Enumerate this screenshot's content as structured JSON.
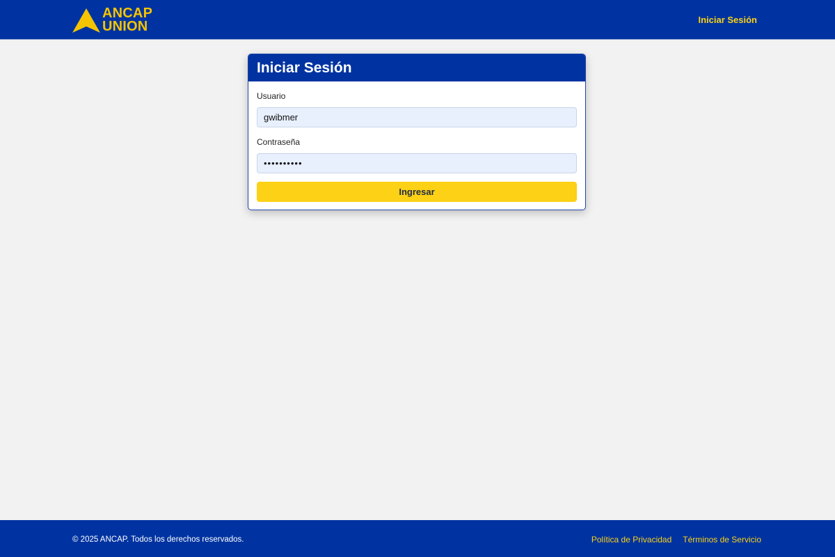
{
  "header": {
    "logo": {
      "line1": "ANCAP",
      "line2": "UNION",
      "icon": "triangle-logo-icon",
      "color": "#f5c400"
    },
    "nav_login": "Iniciar Sesión",
    "background": "#0033a1"
  },
  "login": {
    "title": "Iniciar Sesión",
    "username_label": "Usuario",
    "username_value": "gwibmer",
    "password_label": "Contraseña",
    "password_value": "••••••••••",
    "submit_label": "Ingresar",
    "button_color": "#fcd116"
  },
  "footer": {
    "copyright": "© 2025 ANCAP. Todos los derechos reservados.",
    "links": [
      {
        "label": "Política de Privacidad"
      },
      {
        "label": "Términos de Servicio"
      }
    ]
  },
  "colors": {
    "brand_blue": "#0033a1",
    "brand_yellow": "#fcd116",
    "page_background": "#f2f2f2"
  }
}
